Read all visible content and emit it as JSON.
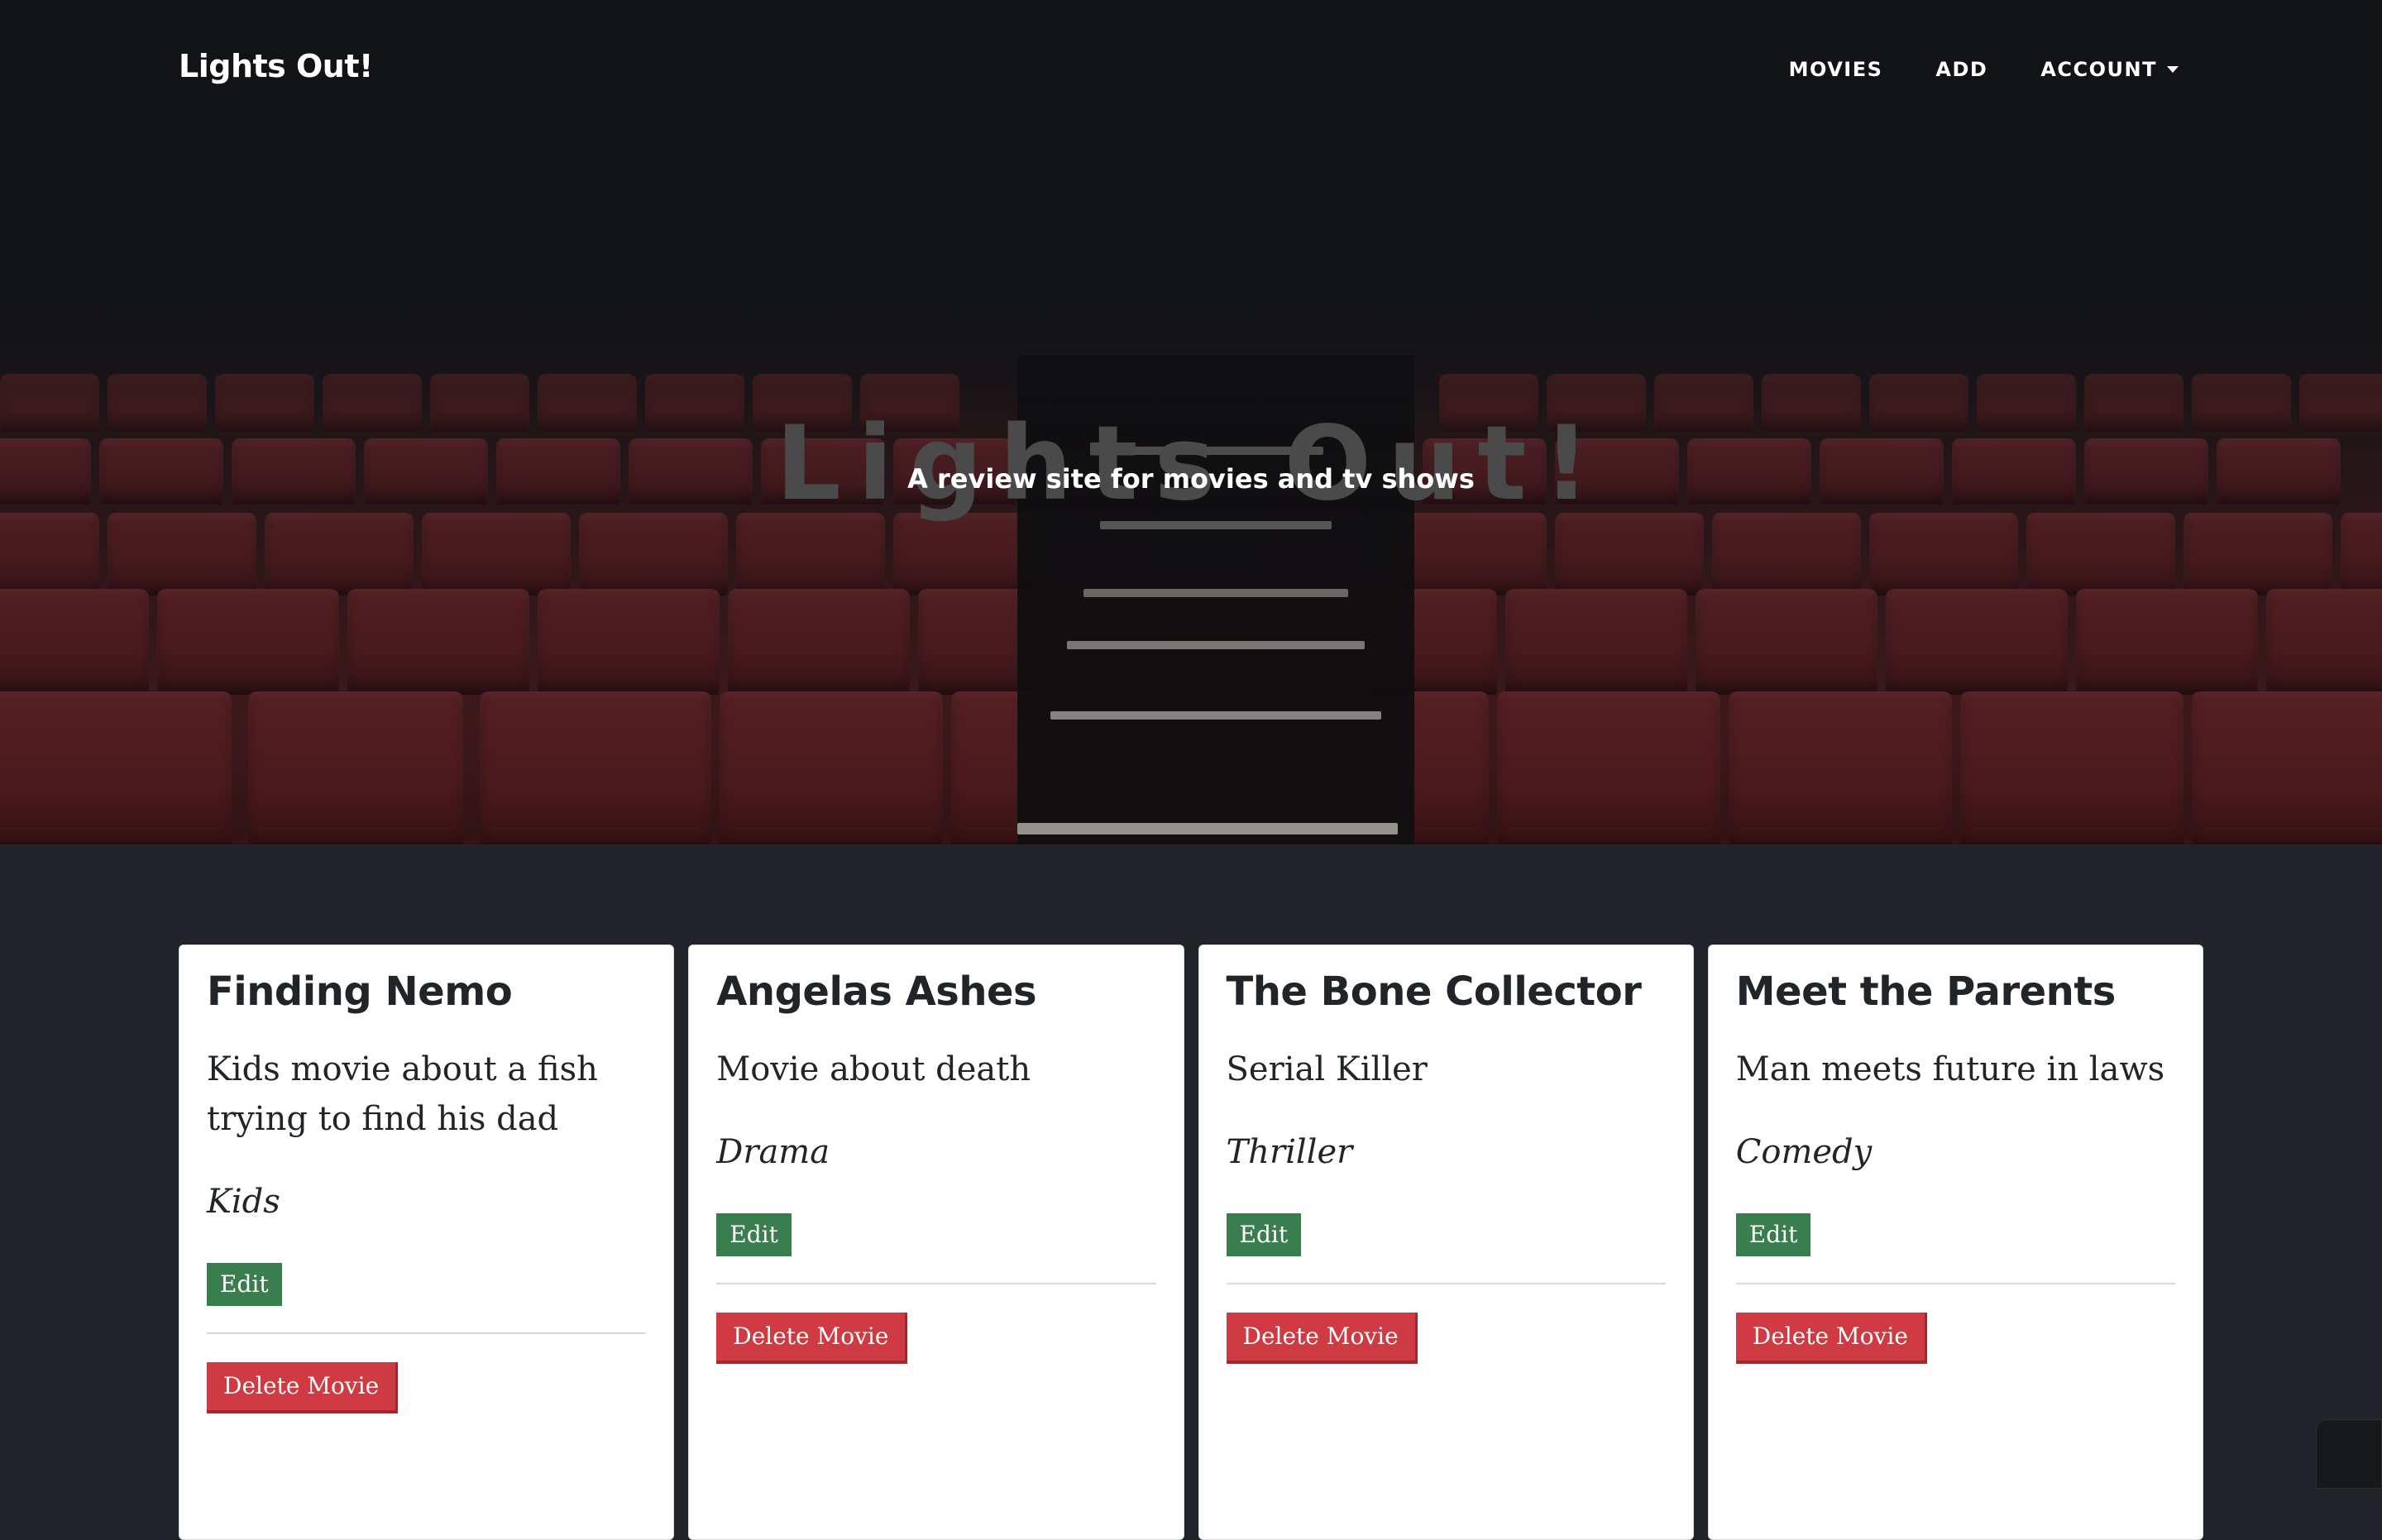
{
  "nav": {
    "brand": "Lights Out!",
    "links": [
      {
        "label": "MOVIES"
      },
      {
        "label": "ADD"
      },
      {
        "label": "ACCOUNT"
      }
    ]
  },
  "hero": {
    "title": "Lights Out!",
    "subtitle": "A review site for movies and tv shows"
  },
  "movies": [
    {
      "title": "Finding Nemo",
      "description": "Kids movie about a fish trying to find his dad",
      "genre": "Kids",
      "edit_label": "Edit",
      "delete_label": "Delete Movie"
    },
    {
      "title": "Angelas Ashes",
      "description": "Movie about death",
      "genre": "Drama",
      "edit_label": "Edit",
      "delete_label": "Delete Movie"
    },
    {
      "title": "The Bone Collector",
      "description": "Serial Killer",
      "genre": "Thriller",
      "edit_label": "Edit",
      "delete_label": "Delete Movie"
    },
    {
      "title": "Meet the Parents",
      "description": "Man meets future in laws",
      "genre": "Comedy",
      "edit_label": "Edit",
      "delete_label": "Delete Movie"
    }
  ],
  "colors": {
    "page_background": "#212529",
    "edit_button": "#3a7d4f",
    "delete_button": "#cf3a43",
    "seat_red": "#5a1e22"
  }
}
